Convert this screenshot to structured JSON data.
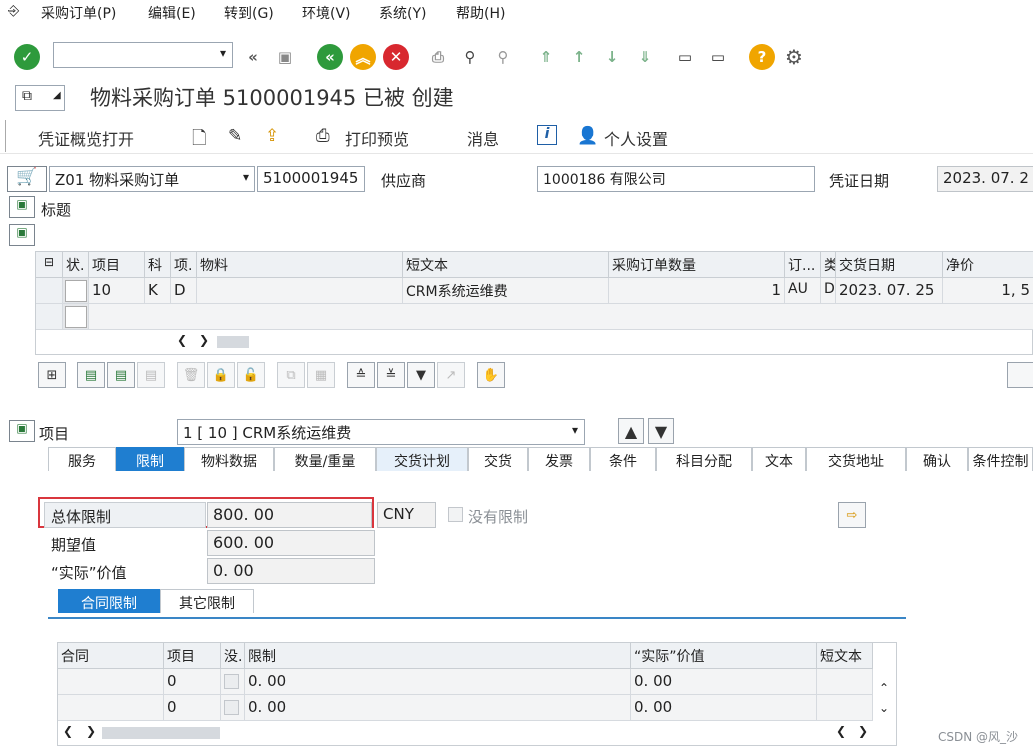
{
  "menu": [
    "采购订单(P)",
    "编辑(E)",
    "转到(G)",
    "环境(V)",
    "系统(Y)",
    "帮助(H)"
  ],
  "title": "物料采购订单 5100001945 已被          创建",
  "app_toolbar": {
    "overview": "凭证概览打开",
    "print_preview": "打印预览",
    "messages": "消息",
    "personal_settings": "个人设置"
  },
  "header": {
    "doc_type": "Z01 物料采购订单",
    "po_number": "5100001945",
    "vendor_label": "供应商",
    "vendor_value": "1000186                        有限公司",
    "doc_date_label": "凭证日期",
    "doc_date": "2023. 07. 2",
    "section_title": "标题"
  },
  "items_table": {
    "columns": [
      "状.",
      "项目",
      "科",
      "项.",
      "物料",
      "短文本",
      "采购订单数量",
      "订...",
      "类",
      "交货日期",
      "净价"
    ],
    "rows": [
      {
        "item": "10",
        "acct": "K",
        "cat": "D",
        "material": "",
        "short_text": "CRM系统运维费",
        "qty": "1",
        "unit": "AU",
        "type": "D",
        "delivery_date": "2023. 07. 25",
        "net_price": "1, 5"
      }
    ]
  },
  "item_detail": {
    "label": "项目",
    "selector": "1 [ 10 ] CRM系统运维费"
  },
  "tabs": [
    "服务",
    "限制",
    "物料数据",
    "数量/重量",
    "交货计划",
    "交货",
    "发票",
    "条件",
    "科目分配",
    "文本",
    "交货地址",
    "确认",
    "条件控制"
  ],
  "limits": {
    "overall_label": "总体限制",
    "overall_value": "800. 00",
    "currency": "CNY",
    "no_limit_label": "没有限制",
    "expected_label": "期望值",
    "expected_value": "600. 00",
    "actual_label": "“实际”价值",
    "actual_value": "0. 00"
  },
  "subtabs": [
    "合同限制",
    "其它限制"
  ],
  "contract_table": {
    "columns": [
      "合同",
      "项目",
      "没.",
      "限制",
      "“实际”价值",
      "短文本"
    ],
    "rows": [
      {
        "item": "0",
        "limit": "0. 00",
        "actual": "0. 00"
      },
      {
        "item": "0",
        "limit": "0. 00",
        "actual": "0. 00"
      }
    ]
  },
  "watermark": "CSDN @风_沙",
  "colors": {
    "accent": "#1f7ed0",
    "highlight_border": "#d9363e"
  }
}
